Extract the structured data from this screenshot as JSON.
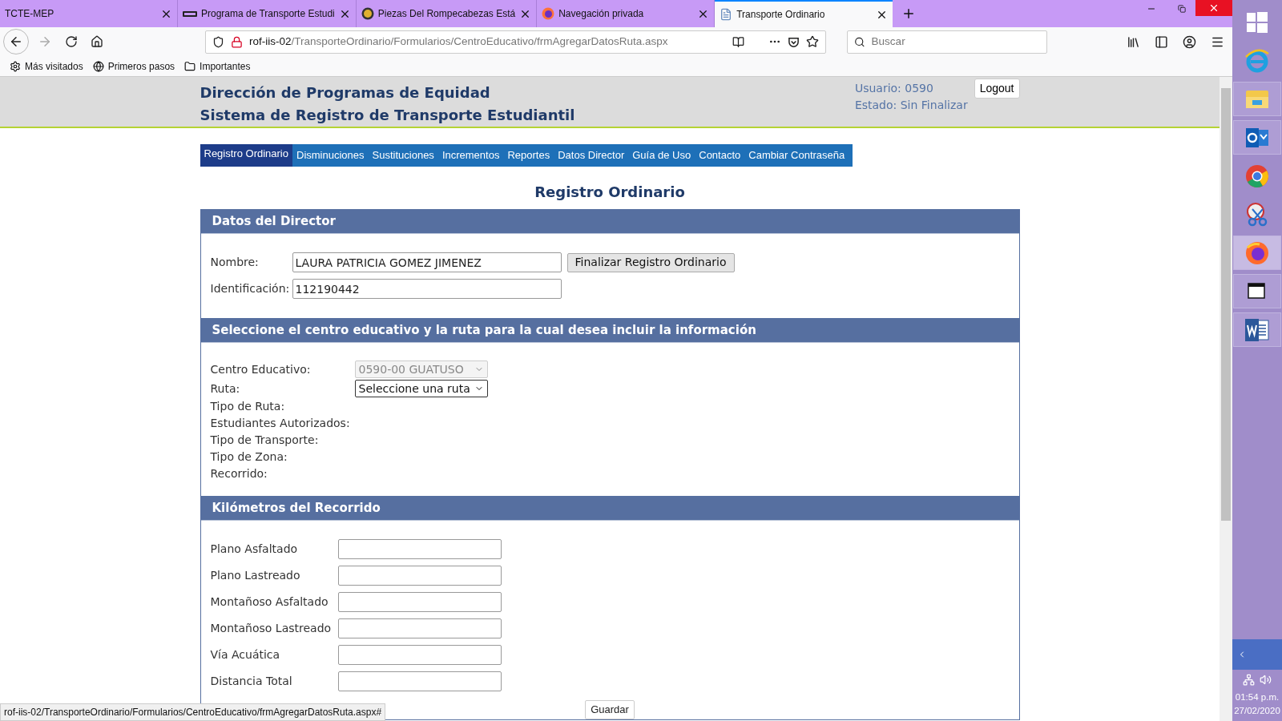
{
  "browser": {
    "tabs": [
      {
        "title": "TCTE-MEP",
        "kind": "none",
        "selected": false
      },
      {
        "title": "Programa de Transporte Estudi",
        "kind": "mep",
        "selected": false
      },
      {
        "title": "Piezas Del Rompecabezas Está",
        "kind": "puzzle",
        "selected": false
      },
      {
        "title": "Navegación privada",
        "kind": "firefox",
        "selected": false
      },
      {
        "title": "Transporte Ordinario",
        "kind": "page",
        "selected": true
      }
    ],
    "url_host": "rof-iis-02",
    "url_path": "/TransporteOrdinario/Formularios/CentroEducativo/frmAgregarDatosRuta.aspx",
    "search": {
      "placeholder": "Buscar"
    },
    "bookmarks": [
      {
        "label": "Más visitados",
        "kind": "gear"
      },
      {
        "label": "Primeros pasos",
        "kind": "globe"
      },
      {
        "label": "Importantes",
        "kind": "folder"
      }
    ]
  },
  "page": {
    "header": {
      "title": "Dirección de Programas de Equidad",
      "subtitle": "Sistema de Registro de Transporte Estudiantil",
      "user": "Usuario: 0590",
      "status": "Estado: Sin Finalizar",
      "logout": "Logout"
    },
    "nav": [
      {
        "label": "Registro Ordinario",
        "selected": true
      },
      {
        "label": "Disminuciones",
        "selected": false
      },
      {
        "label": "Sustituciones",
        "selected": false
      },
      {
        "label": "Incrementos",
        "selected": false
      },
      {
        "label": "Reportes",
        "selected": false
      },
      {
        "label": "Datos Director",
        "selected": false
      },
      {
        "label": "Guía de Uso",
        "selected": false
      },
      {
        "label": "Contacto",
        "selected": false
      },
      {
        "label": "Cambiar Contraseña",
        "selected": false
      }
    ],
    "title": "Registro Ordinario",
    "director": {
      "title": "Datos del Director",
      "fields": [
        {
          "label": "Nombre:",
          "value": "LAURA PATRICIA GOMEZ JIMENEZ"
        },
        {
          "label": "Identificación:",
          "value": "112190442"
        }
      ],
      "button": "Finalizar Registro Ordinario"
    },
    "route": {
      "title": "Seleccione el centro educativo y la ruta para la cual desea incluir la información",
      "rows": [
        {
          "label": "Centro Educativo:",
          "kind": "select",
          "value": "0590-00 GUATUSO",
          "disabled": true
        },
        {
          "label": "Ruta:",
          "kind": "select",
          "value": "Seleccione una ruta",
          "disabled": false
        },
        {
          "label": "Tipo de Ruta:",
          "kind": "info"
        },
        {
          "label": "Estudiantes Autorizados:",
          "kind": "info"
        },
        {
          "label": "Tipo de Transporte:",
          "kind": "info"
        },
        {
          "label": "Tipo de Zona:",
          "kind": "info"
        },
        {
          "label": "Recorrido:",
          "kind": "info"
        }
      ]
    },
    "km": {
      "title": "Kilómetros del Recorrido",
      "fields": [
        {
          "label": "Plano Asfaltado"
        },
        {
          "label": "Plano Lastreado"
        },
        {
          "label": "Montañoso Asfaltado"
        },
        {
          "label": "Montañoso Lastreado"
        },
        {
          "label": "Vía Acuática"
        },
        {
          "label": "Distancia Total"
        }
      ]
    },
    "save_button": "Guardar"
  },
  "status_bar": "rof-iis-02/TransporteOrdinario/Formularios/CentroEducativo/frmAgregarDatosRuta.aspx#",
  "taskbar": {
    "apps": [
      {
        "kind": "windows",
        "running": false,
        "active": false
      },
      {
        "kind": "ie",
        "running": false,
        "active": false
      },
      {
        "kind": "explorer",
        "running": true,
        "active": false
      },
      {
        "kind": "outlook",
        "running": true,
        "active": false
      },
      {
        "kind": "chrome",
        "running": false,
        "active": false
      },
      {
        "kind": "snipping",
        "running": false,
        "active": false
      },
      {
        "kind": "firefox",
        "running": true,
        "active": true
      },
      {
        "kind": "window",
        "running": true,
        "active": false
      },
      {
        "kind": "word",
        "running": true,
        "active": false
      }
    ],
    "time": "01:54 p.m.",
    "date": "27/02/2020"
  }
}
